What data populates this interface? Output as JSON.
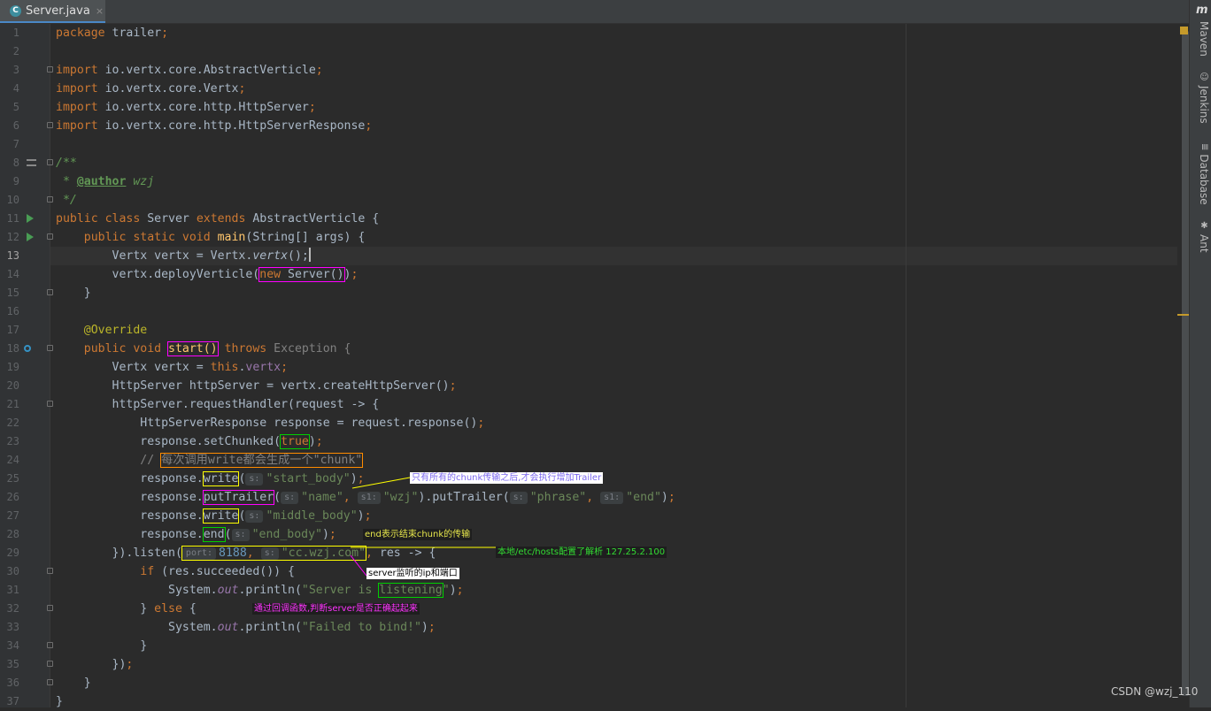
{
  "tab": {
    "icon": "class-icon",
    "filename": "Server.java",
    "close": "×"
  },
  "line_numbers": [
    "1",
    "2",
    "3",
    "4",
    "5",
    "6",
    "7",
    "8",
    "9",
    "10",
    "11",
    "12",
    "13",
    "14",
    "15",
    "16",
    "17",
    "18",
    "19",
    "20",
    "21",
    "22",
    "23",
    "24",
    "25",
    "26",
    "27",
    "28",
    "29",
    "30",
    "31",
    "32",
    "33",
    "34",
    "35",
    "36",
    "37"
  ],
  "current_line": "13",
  "code": {
    "l1": [
      "package",
      " trailer",
      ";"
    ],
    "l3": [
      "import",
      " io.vertx.core.AbstractVerticle",
      ";"
    ],
    "l4": [
      "import",
      " io.vertx.core.Vertx",
      ";"
    ],
    "l5": [
      "import",
      " io.vertx.core.http.HttpServer",
      ";"
    ],
    "l6": [
      "import",
      " io.vertx.core.http.HttpServerResponse",
      ";"
    ],
    "l8": "/**",
    "l9": [
      " * ",
      "@author",
      " wzj"
    ],
    "l10": " */",
    "l11": [
      "public class",
      " Server ",
      "extends",
      " AbstractVerticle {"
    ],
    "l12": [
      "    public static void",
      " main",
      "(String[] args) {"
    ],
    "l13": [
      "        Vertx vertx = Vertx.",
      "vertx",
      "();"
    ],
    "l14": [
      "        vertx.deployVerticle(",
      "new",
      " Server()",
      ")",
      ";"
    ],
    "l15": "    }",
    "l17": "    @Override",
    "l18": [
      "    public void",
      " ",
      "start()",
      " ",
      "throws",
      " Exception {"
    ],
    "l19": [
      "        Vertx vertx = ",
      "this",
      ".",
      "vertx",
      ";"
    ],
    "l20": [
      "        HttpServer httpServer = vertx.createHttpServer()",
      ";"
    ],
    "l21": "        httpServer.requestHandler(request -> {",
    "l22": [
      "            HttpServerResponse response = request.response()",
      ";"
    ],
    "l23": [
      "            response.setChunked(",
      "true",
      ")",
      ";"
    ],
    "l24": [
      "            // ",
      "每次调用write都会生成一个\"chunk\""
    ],
    "l25": [
      "            response.",
      "write",
      "(",
      "s:",
      "\"start_body\"",
      ")",
      ";"
    ],
    "l26": [
      "            response.",
      "putTrailer",
      "(",
      "s:",
      "\"name\"",
      ", ",
      "s1:",
      "\"wzj\"",
      ").putTrailer(",
      "s:",
      "\"phrase\"",
      ", ",
      "s1:",
      "\"end\"",
      ")",
      ";"
    ],
    "l27": [
      "            response.",
      "write",
      "(",
      "s:",
      "\"middle_body\"",
      ")",
      ";"
    ],
    "l28": [
      "            response.",
      "end",
      "(",
      "s:",
      "\"end_body\"",
      ")",
      ";"
    ],
    "l29": [
      "        }).listen(",
      "port:",
      "8188",
      ", ",
      "s:",
      "\"cc.wzj.com\"",
      ",",
      " res -> {"
    ],
    "l30": [
      "            ",
      "if",
      " (res.succeeded()) {"
    ],
    "l31": [
      "                System.",
      "out",
      ".println(",
      "\"Server is ",
      "listening",
      "\"",
      ")",
      ";"
    ],
    "l32": [
      "            } ",
      "else",
      " {"
    ],
    "l33": [
      "                System.",
      "out",
      ".println(",
      "\"Failed to bind!\"",
      ")",
      ";"
    ],
    "l34": "            }",
    "l35": [
      "        })",
      ";"
    ],
    "l36": "    }",
    "l37": "}"
  },
  "annotations": {
    "trailer_note": "只有所有的chunk传输之后,才会执行增加Trailer",
    "end_note": "end表示结束chunk的传输",
    "hosts_note": "本地/etc/hosts配置了解析 127.25.2.100",
    "listen_note": "server监听的ip和端口",
    "callback_note": "通过回调函数,判断server是否正确起起来"
  },
  "colors": {
    "callout_white_bg": "#ffffff",
    "callout_dark_bg": "#1e1e1e",
    "magenta": "#ff00ff",
    "green": "#00d000",
    "yellow": "#ffff00",
    "orange": "#ff8c00"
  },
  "toolwindows": [
    "Maven",
    "Jenkins",
    "Database",
    "Ant"
  ],
  "toolwindow_icons": [
    "maven-icon",
    "jenkins-icon",
    "database-icon",
    "ant-icon"
  ],
  "watermark": "CSDN @wzj_110"
}
